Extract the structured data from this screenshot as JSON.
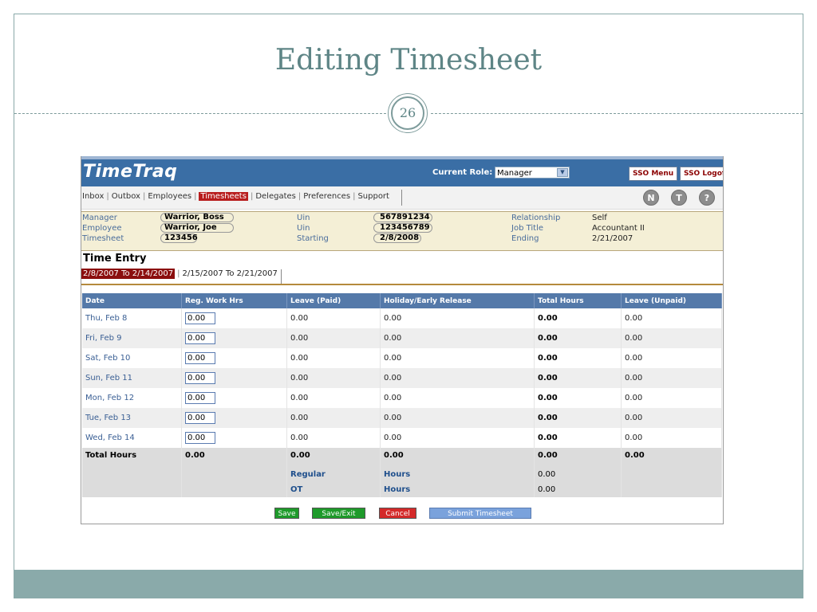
{
  "slide": {
    "title": "Editing Timesheet",
    "page_number": "26"
  },
  "app": {
    "logo": "TimeTraq",
    "current_role_label": "Current Role:",
    "current_role_value": "Manager",
    "sso_menu": "SSO Menu",
    "sso_logoff": "SSO Logoff",
    "nav": {
      "items": [
        "Inbox",
        "Outbox",
        "Employees",
        "Timesheets",
        "Delegates",
        "Preferences",
        "Support"
      ],
      "active": "Timesheets"
    },
    "icons": {
      "n": "N",
      "t": "T",
      "help": "?"
    }
  },
  "info": {
    "manager_label": "Manager",
    "manager_value": "Warrior, Boss",
    "employee_label": "Employee",
    "employee_value": "Warrior, Joe",
    "timesheet_label": "Timesheet",
    "timesheet_value": "123456",
    "uin1_label": "Uin",
    "uin1_value": "567891234",
    "uin2_label": "Uin",
    "uin2_value": "123456789",
    "starting_label": "Starting",
    "starting_value": "2/8/2008",
    "relationship_label": "Relationship",
    "relationship_value": "Self",
    "jobtitle_label": "Job Title",
    "jobtitle_value": "Accountant II",
    "ending_label": "Ending",
    "ending_value": "2/21/2007"
  },
  "time_entry": {
    "title": "Time Entry",
    "period_tabs": [
      "2/8/2007 To 2/14/2007",
      "2/15/2007 To 2/21/2007"
    ],
    "columns": [
      "Date",
      "Reg. Work Hrs",
      "Leave (Paid)",
      "Holiday/Early Release",
      "Total Hours",
      "Leave (Unpaid)"
    ],
    "rows": [
      {
        "date": "Thu, Feb 8",
        "reg": "0.00",
        "leave_paid": "0.00",
        "holiday": "0.00",
        "total": "0.00",
        "leave_unpaid": "0.00"
      },
      {
        "date": "Fri, Feb 9",
        "reg": "0.00",
        "leave_paid": "0.00",
        "holiday": "0.00",
        "total": "0.00",
        "leave_unpaid": "0.00"
      },
      {
        "date": "Sat, Feb 10",
        "reg": "0.00",
        "leave_paid": "0.00",
        "holiday": "0.00",
        "total": "0.00",
        "leave_unpaid": "0.00"
      },
      {
        "date": "Sun, Feb 11",
        "reg": "0.00",
        "leave_paid": "0.00",
        "holiday": "0.00",
        "total": "0.00",
        "leave_unpaid": "0.00"
      },
      {
        "date": "Mon, Feb 12",
        "reg": "0.00",
        "leave_paid": "0.00",
        "holiday": "0.00",
        "total": "0.00",
        "leave_unpaid": "0.00"
      },
      {
        "date": "Tue, Feb 13",
        "reg": "0.00",
        "leave_paid": "0.00",
        "holiday": "0.00",
        "total": "0.00",
        "leave_unpaid": "0.00"
      },
      {
        "date": "Wed, Feb 14",
        "reg": "0.00",
        "leave_paid": "0.00",
        "holiday": "0.00",
        "total": "0.00",
        "leave_unpaid": "0.00"
      }
    ],
    "totals": {
      "label": "Total Hours",
      "reg": "0.00",
      "leave_paid": "0.00",
      "holiday": "0.00",
      "total": "0.00",
      "leave_unpaid": "0.00"
    },
    "regular": {
      "label": "Regular",
      "unit": "Hours",
      "value": "0.00"
    },
    "ot": {
      "label": "OT",
      "unit": "Hours",
      "value": "0.00"
    }
  },
  "buttons": {
    "save": "Save",
    "save_exit": "Save/Exit",
    "cancel": "Cancel",
    "submit": "Submit Timesheet"
  },
  "colors": {
    "header_blue": "#3a6ea5",
    "active_red": "#b81d1d",
    "save_green": "#1e9a2a",
    "cancel_red": "#d42a2a",
    "submit_blue": "#7aa2dc",
    "slide_accent": "#5e8586"
  }
}
